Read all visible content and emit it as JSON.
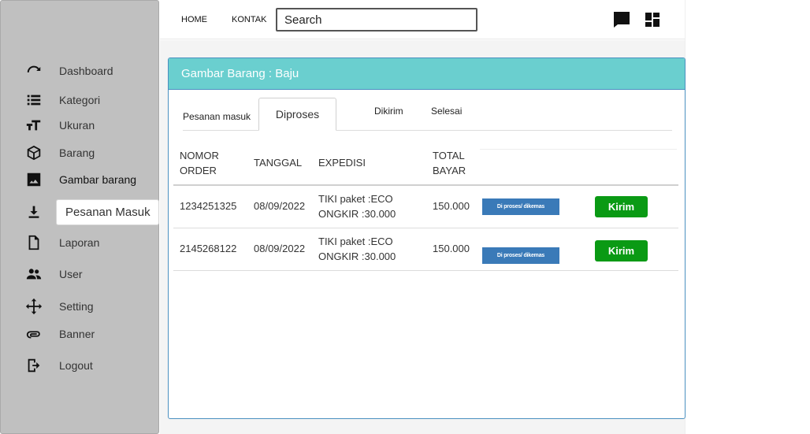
{
  "sidebar": {
    "items": [
      {
        "label": "Dashboard",
        "icon": "dashboard-icon"
      },
      {
        "label": "Kategori",
        "icon": "list-icon"
      },
      {
        "label": "Ukuran",
        "icon": "text-size-icon"
      },
      {
        "label": "Barang",
        "icon": "box-icon"
      },
      {
        "label": "Gambar barang",
        "icon": "image-icon"
      },
      {
        "label": "Pesanan Masuk",
        "icon": "download-icon"
      },
      {
        "label": "Laporan",
        "icon": "file-icon"
      },
      {
        "label": "User",
        "icon": "users-icon"
      },
      {
        "label": "Setting",
        "icon": "move-icon"
      },
      {
        "label": "Banner",
        "icon": "link-icon"
      },
      {
        "label": "Logout",
        "icon": "logout-icon"
      }
    ]
  },
  "topbar": {
    "home_label": "HOME",
    "kontak_label": "KONTAK",
    "search_placeholder": "Search"
  },
  "panel": {
    "title": "Gambar Barang : Baju",
    "tabs": [
      "Pesanan masuk",
      "Diproses",
      "Dikirim",
      "Selesai"
    ],
    "active_tab": "Diproses"
  },
  "table": {
    "headers": {
      "nomor_order": [
        "NOMOR",
        "ORDER"
      ],
      "tanggal": "TANGGAL",
      "expedisi": "EXPEDISI",
      "total_bayar": [
        "TOTAL",
        "BAYAR"
      ]
    },
    "rows": [
      {
        "nomor": "1234251325",
        "tanggal": "08/09/2022",
        "expedisi": [
          "TIKI paket :ECO",
          "ONGKIR :30.000"
        ],
        "total": "150.000",
        "status": "Di proses/ dikemas",
        "action": "Kirim"
      },
      {
        "nomor": "2145268122",
        "tanggal": "08/09/2022",
        "expedisi": [
          "TIKI paket :ECO",
          "ONGKIR :30.000"
        ],
        "total": "150.000",
        "status": "Di proses/ dikemas",
        "action": "Kirim"
      }
    ]
  },
  "colors": {
    "sidebar_bg": "#c0c0c0",
    "panel_header": "#6acfcf",
    "status_badge": "#3a7ab8",
    "kirim_button": "#0a9a14"
  }
}
